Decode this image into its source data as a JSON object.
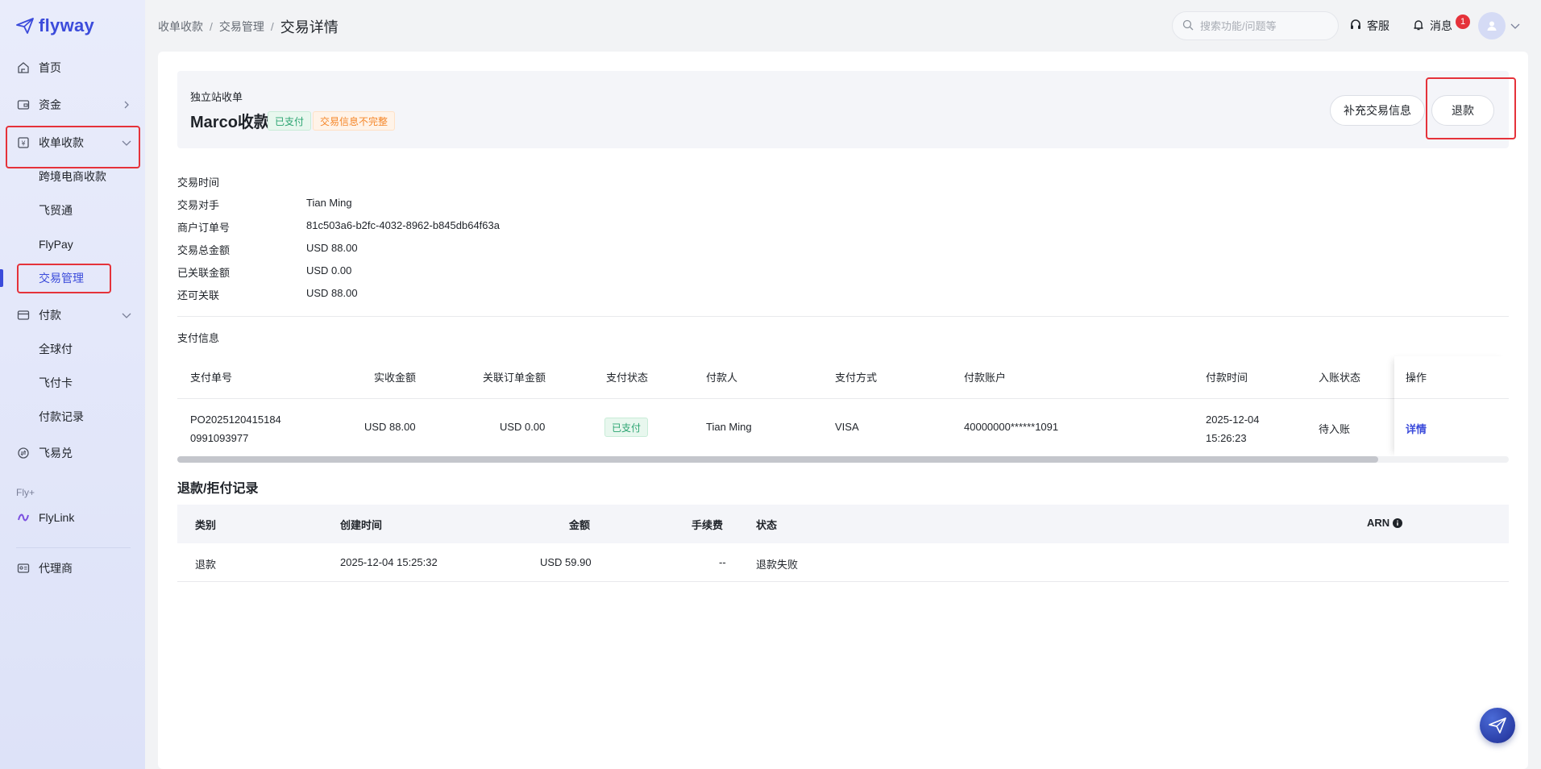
{
  "brand": {
    "name": "flyway"
  },
  "sidebar": {
    "items": [
      {
        "label": "首页",
        "icon": "home-icon"
      },
      {
        "label": "资金",
        "icon": "wallet-icon"
      },
      {
        "label": "收单收款",
        "icon": "receipt-icon"
      },
      {
        "label": "付款",
        "icon": "card-icon"
      },
      {
        "label": "飞易兑",
        "icon": "exchange-icon"
      }
    ],
    "collection_sub": [
      "跨境电商收款",
      "飞贸通",
      "FlyPay",
      "交易管理"
    ],
    "payment_sub": [
      "全球付",
      "飞付卡",
      "付款记录"
    ],
    "group_label": "Fly+",
    "flylink": "FlyLink",
    "agent": "代理商"
  },
  "header": {
    "breadcrumb": [
      "收单收款",
      "交易管理"
    ],
    "current": "交易详情",
    "search_placeholder": "搜索功能/问题等",
    "support": "客服",
    "messages": "消息",
    "message_count": "1"
  },
  "summary": {
    "subtitle": "独立站收单",
    "title": "Marco收款",
    "tag_paid": "已支付",
    "tag_incomplete": "交易信息不完整",
    "btn_supplement": "补充交易信息",
    "btn_refund": "退款"
  },
  "info": [
    {
      "label": "交易时间",
      "value": ""
    },
    {
      "label": "交易对手",
      "value": "Tian Ming"
    },
    {
      "label": "商户订单号",
      "value": "81c503a6-b2fc-4032-8962-b845db64f63a"
    },
    {
      "label": "交易总金额",
      "value": "USD 88.00"
    },
    {
      "label": "已关联金额",
      "value": "USD 0.00"
    },
    {
      "label": "还可关联",
      "value": "USD 88.00"
    }
  ],
  "payment": {
    "section_title": "支付信息",
    "columns": [
      "支付单号",
      "实收金额",
      "关联订单金额",
      "支付状态",
      "付款人",
      "支付方式",
      "付款账户",
      "付款时间",
      "入账状态",
      "操作"
    ],
    "row": {
      "id_line1": "PO2025120415184",
      "id_line2": "0991093977",
      "received": "USD 88.00",
      "linked": "USD 0.00",
      "status": "已支付",
      "payer": "Tian Ming",
      "method": "VISA",
      "account": "40000000******1091",
      "time_line1": "2025-12-04",
      "time_line2": "15:26:23",
      "entry_status": "待入账",
      "action": "详情"
    }
  },
  "refunds": {
    "title": "退款/拒付记录",
    "columns": [
      "类别",
      "创建时间",
      "金额",
      "手续费",
      "状态",
      "ARN"
    ],
    "rows": [
      {
        "type": "退款",
        "created": "2025-12-04 15:25:32",
        "amount": "USD 59.90",
        "fee": "--",
        "status": "退款失败",
        "arn": ""
      }
    ]
  }
}
